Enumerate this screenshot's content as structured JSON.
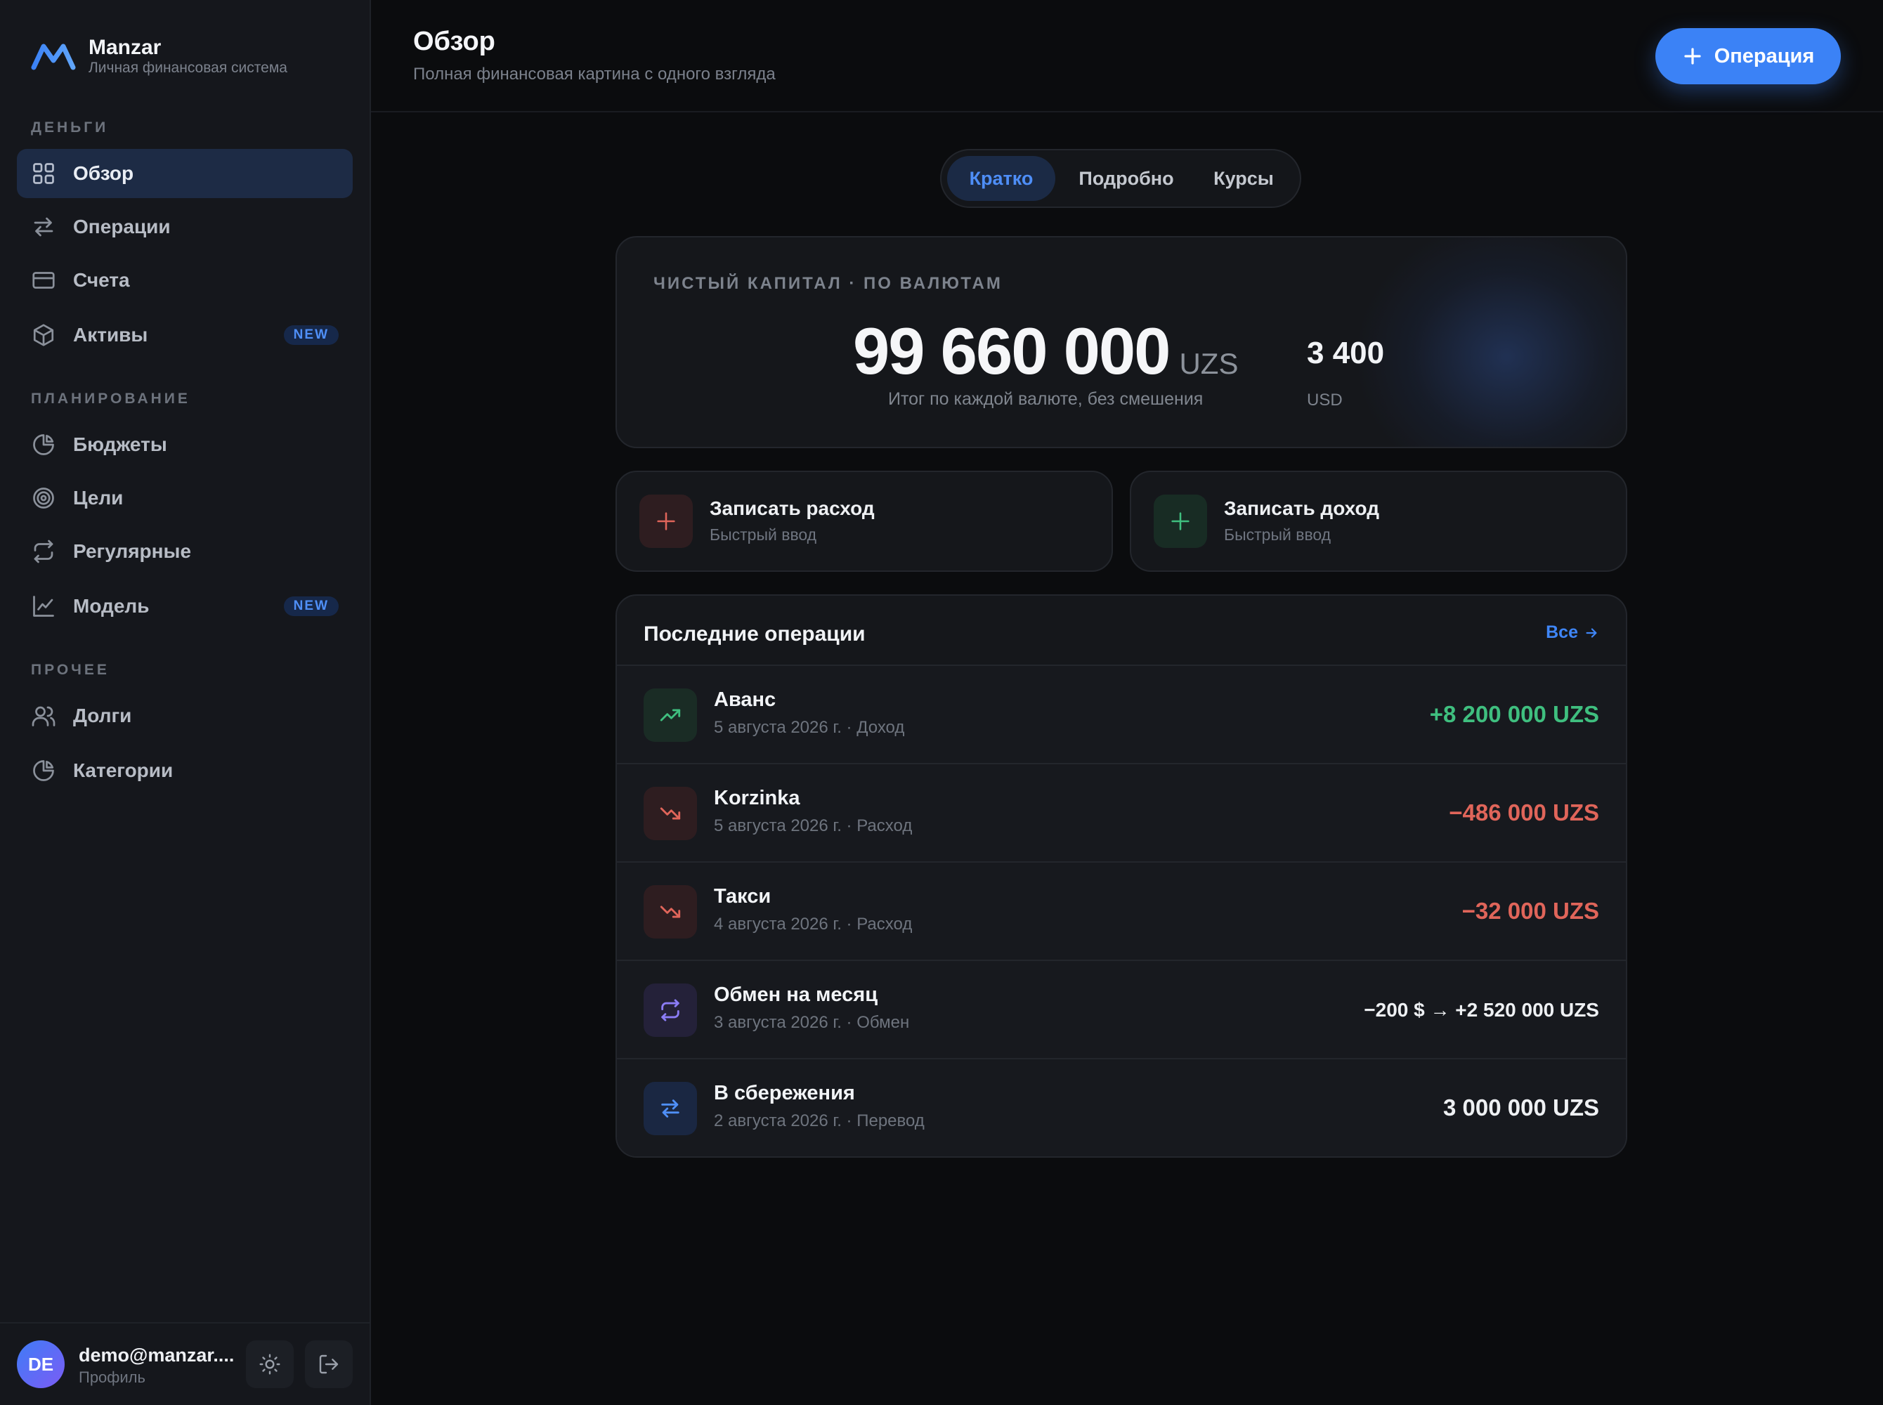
{
  "brand": {
    "name": "Manzar",
    "subtitle": "Личная финансовая система"
  },
  "sidebar": {
    "sections": [
      {
        "title": "ДЕНЬГИ"
      },
      {
        "title": "ПЛАНИРОВАНИЕ"
      },
      {
        "title": "ПРОЧЕЕ"
      }
    ],
    "items": [
      {
        "label": "Обзор",
        "icon": "grid-icon",
        "active": true
      },
      {
        "label": "Операции",
        "icon": "arrows-swap-icon"
      },
      {
        "label": "Счета",
        "icon": "card-icon"
      },
      {
        "label": "Активы",
        "icon": "cube-icon",
        "badge": "NEW"
      },
      {
        "label": "Бюджеты",
        "icon": "pie-chart-icon"
      },
      {
        "label": "Цели",
        "icon": "target-icon"
      },
      {
        "label": "Регулярные",
        "icon": "repeat-icon"
      },
      {
        "label": "Модель",
        "icon": "line-chart-icon",
        "badge": "NEW"
      },
      {
        "label": "Долги",
        "icon": "users-icon"
      },
      {
        "label": "Категории",
        "icon": "pie-chart-icon"
      }
    ]
  },
  "user": {
    "initials": "DE",
    "email": "demo@manzar....",
    "profile_label": "Профиль"
  },
  "header": {
    "title": "Обзор",
    "subtitle": "Полная финансовая картина с одного взгляда",
    "add_button_label": "Операция"
  },
  "tabs": [
    {
      "label": "Кратко",
      "active": true
    },
    {
      "label": "Подробно"
    },
    {
      "label": "Курсы"
    }
  ],
  "net_worth": {
    "label": "ЧИСТЫЙ КАПИТАЛ · ПО ВАЛЮТАМ",
    "primary_value": "99 660 000",
    "primary_currency": "UZS",
    "note": "Итог по каждой валюте, без смешения",
    "secondary_value": "3 400",
    "secondary_currency": "USD"
  },
  "quick_actions": [
    {
      "title": "Записать расход",
      "subtitle": "Быстрый ввод",
      "kind": "expense",
      "color": "#e0655a"
    },
    {
      "title": "Записать доход",
      "subtitle": "Быстрый ввод",
      "kind": "income",
      "color": "#3fbf7f"
    }
  ],
  "recent": {
    "title": "Последние операции",
    "see_all_label": "Все",
    "operations": [
      {
        "name": "Аванс",
        "meta": "5 августа 2026 г. · Доход",
        "amount": "+8 200 000 UZS",
        "type": "income",
        "icon": "trend-up-icon"
      },
      {
        "name": "Korzinka",
        "meta": "5 августа 2026 г. · Расход",
        "amount": "−486 000 UZS",
        "type": "expense",
        "icon": "trend-down-icon"
      },
      {
        "name": "Такси",
        "meta": "4 августа 2026 г. · Расход",
        "amount": "−32 000 UZS",
        "type": "expense",
        "icon": "trend-down-icon"
      },
      {
        "name": "Обмен на месяц",
        "meta": "3 августа 2026 г. · Обмен",
        "amount": "−200 $ → +2 520 000 UZS",
        "type": "exchange",
        "icon": "repeat-icon"
      },
      {
        "name": "В сбережения",
        "meta": "2 августа 2026 г. · Перевод",
        "amount": "3 000 000 UZS",
        "type": "transfer",
        "icon": "arrows-swap-icon"
      }
    ]
  },
  "colors": {
    "accent": "#3b82f6",
    "income": "#3fbf7f",
    "expense": "#e0655a",
    "exchange": "#8b7cf6",
    "background": "#0b0c0e",
    "sidebar": "#15171c"
  }
}
